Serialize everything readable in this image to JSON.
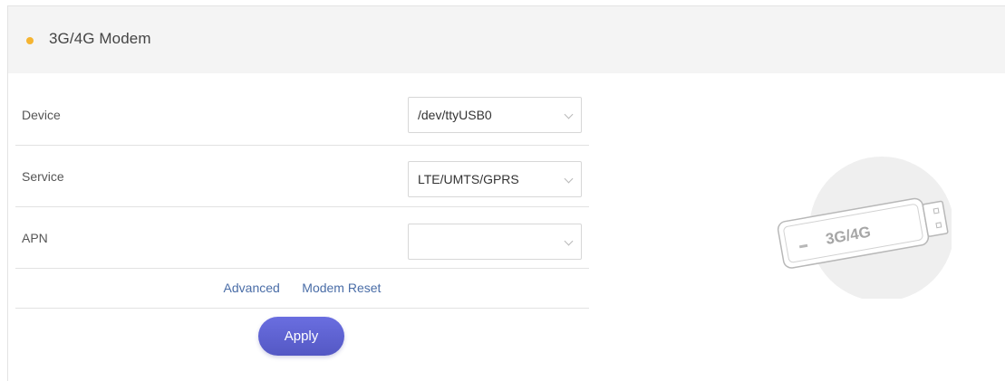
{
  "header": {
    "title": "3G/4G Modem"
  },
  "form": {
    "device": {
      "label": "Device",
      "value": "/dev/ttyUSB0"
    },
    "service": {
      "label": "Service",
      "value": "LTE/UMTS/GPRS"
    },
    "apn": {
      "label": "APN",
      "value": ""
    }
  },
  "links": {
    "advanced": "Advanced",
    "modem_reset": "Modem Reset"
  },
  "actions": {
    "apply": "Apply"
  },
  "illustration": {
    "text": "3G/4G",
    "icon": "usb-modem-icon"
  },
  "colors": {
    "accent_dot": "#f5b431",
    "button": "#5d61d3",
    "link": "#4a6da7"
  }
}
